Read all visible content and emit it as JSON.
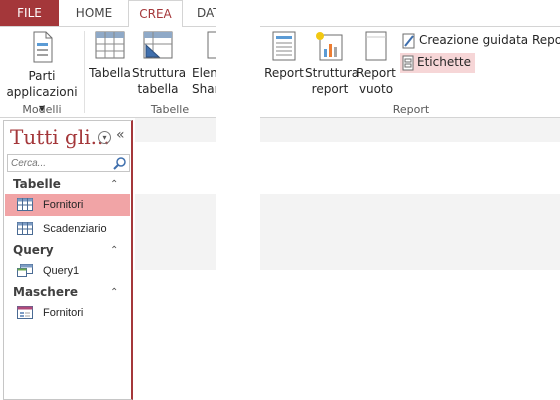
{
  "tabs": {
    "file": "FILE",
    "home": "HOME",
    "crea": "CREA",
    "dati": "DAT"
  },
  "ribbon": {
    "modelli": {
      "label": "Modelli",
      "parti_line1": "Parti",
      "parti_line2": "applicazioni ▾"
    },
    "tabelle": {
      "label": "Tabelle",
      "tabella": "Tabella",
      "struttura_line1": "Struttura",
      "struttura_line2": "tabella",
      "elenchi_line1": "Elenc",
      "elenchi_line2": "Sharel"
    },
    "report": {
      "label": "Report",
      "report": "Report",
      "struttura_line1": "Struttura",
      "struttura_line2": "report",
      "vuoto_line1": "Report",
      "vuoto_line2": "vuoto",
      "creazione_guidata": "Creazione guidata Report",
      "etichette": "Etichette"
    }
  },
  "nav": {
    "title": "Tutti gli...",
    "search_placeholder": "Cerca...",
    "groups": [
      {
        "title": "Tabelle",
        "items": [
          "Fornitori",
          "Scadenziario"
        ]
      },
      {
        "title": "Query",
        "items": [
          "Query1"
        ]
      },
      {
        "title": "Maschere",
        "items": [
          "Fornitori"
        ]
      }
    ]
  },
  "colors": {
    "accent": "#a4373a",
    "selected_item": "#f1a4a6",
    "highlighted_button": "#f6d6d7"
  }
}
